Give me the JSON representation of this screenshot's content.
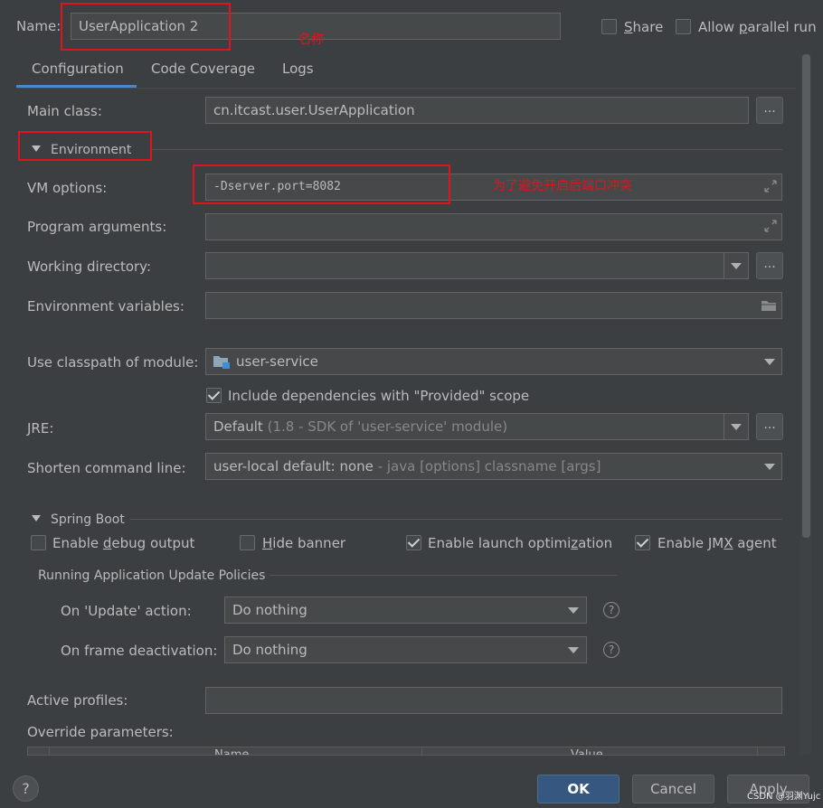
{
  "header": {
    "name_label": "Name:",
    "name_value": "UserApplication 2",
    "annotation_name": "名称",
    "share_label": "Share",
    "parallel_label": "Allow parallel run"
  },
  "tabs": [
    {
      "label": "Configuration",
      "active": true
    },
    {
      "label": "Code Coverage",
      "active": false
    },
    {
      "label": "Logs",
      "active": false
    }
  ],
  "config": {
    "main_class_label": "Main class:",
    "main_class_value": "cn.itcast.user.UserApplication",
    "environment_label": "Environment",
    "vm_options_label": "VM options:",
    "vm_options_value": "-Dserver.port=8082",
    "vm_annotation": "为了避免开启后端口冲突",
    "program_args_label": "Program arguments:",
    "working_dir_label": "Working directory:",
    "env_vars_label": "Environment variables:",
    "classpath_label": "Use classpath of module:",
    "classpath_value": "user-service",
    "include_deps_label": "Include dependencies with \"Provided\" scope",
    "jre_label": "JRE:",
    "jre_value": "Default",
    "jre_detail": "(1.8 - SDK of 'user-service' module)",
    "shorten_label": "Shorten command line:",
    "shorten_value": "user-local default: none",
    "shorten_detail": "- java [options] classname [args]"
  },
  "spring_boot": {
    "section_label": "Spring Boot",
    "debug_output": "Enable debug output",
    "hide_banner": "Hide banner",
    "launch_opt": "Enable launch optimization",
    "jmx_agent": "Enable JMX agent",
    "policies_label": "Running Application Update Policies",
    "update_action_label": "On 'Update' action:",
    "update_action_value": "Do nothing",
    "frame_deact_label": "On frame deactivation:",
    "frame_deact_value": "Do nothing",
    "active_profiles_label": "Active profiles:",
    "override_label": "Override parameters:",
    "col_name": "Name",
    "col_value": "Value"
  },
  "footer": {
    "help": "?",
    "ok": "OK",
    "cancel": "Cancel",
    "apply": "Apply",
    "watermark": "CSDN @羽渊Yujc"
  }
}
